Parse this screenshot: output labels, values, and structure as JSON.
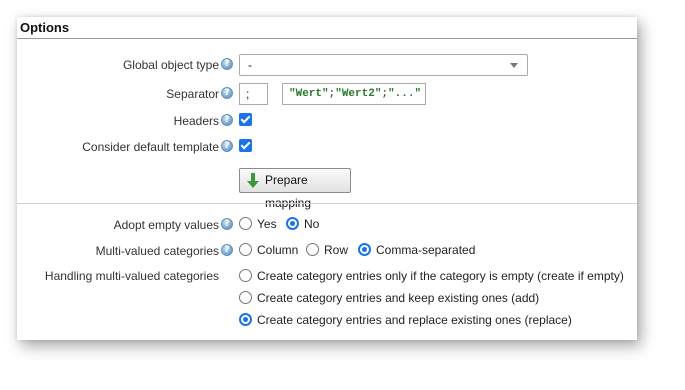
{
  "title": "Options",
  "global_object_type": {
    "label": "Global object type",
    "value": "-"
  },
  "separator": {
    "label": "Separator",
    "value": ";",
    "sample": {
      "s1": "\"Wert\"",
      "sep1": ";",
      "s2": "\"Wert2\"",
      "sep2": ";",
      "s3": "\"...\""
    }
  },
  "headers": {
    "label": "Headers",
    "checked": true
  },
  "default_template": {
    "label": "Consider default template",
    "checked": true
  },
  "prepare_mapping": {
    "label": "Prepare mapping"
  },
  "adopt_empty": {
    "label": "Adopt empty values",
    "options": [
      {
        "label": "Yes",
        "selected": false
      },
      {
        "label": "No",
        "selected": true
      }
    ]
  },
  "multi_valued": {
    "label": "Multi-valued categories",
    "options": [
      {
        "label": "Column",
        "selected": false
      },
      {
        "label": "Row",
        "selected": false
      },
      {
        "label": "Comma-separated",
        "selected": true
      }
    ]
  },
  "handling": {
    "label": "Handling multi-valued categories",
    "options": [
      {
        "label": "Create category entries only if the category is empty (create if empty)",
        "selected": false
      },
      {
        "label": "Create category entries and keep existing ones (add)",
        "selected": false
      },
      {
        "label": "Create category entries and replace existing ones (replace)",
        "selected": true
      }
    ]
  },
  "colors": {
    "accent": "#1a73e8",
    "sample_string": "#2a7a2a",
    "help_icon": "#5a8fc4"
  }
}
